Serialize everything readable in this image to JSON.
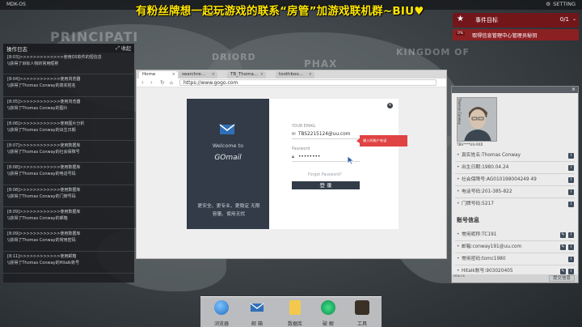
{
  "topbar": {
    "os_label": "MDK-OS",
    "banner": "有粉丝牌想一起玩游戏的联系“房管”加游戏联机群~BIU",
    "setting_label": "SETTING"
  },
  "map": {
    "labels": [
      "PRINCIPATI",
      "DRIORD",
      "PHAX",
      "KINGDOM OF"
    ]
  },
  "log_panel": {
    "title": "操作日志",
    "collapse_label": "收起",
    "entries": [
      {
        "line1": "[8:03]>>>>>>>>>>>>>使用OS软件的短信息",
        "line2": "\\\\获得了目标人物的常用昵称"
      },
      {
        "line1": "[8:04]>>>>>>>>>>>>使用浏览器",
        "line2": "\\\\获得了Thomas Conway的真实姓名"
      },
      {
        "line1": "[8:05]>>>>>>>>>>>>使用浏览器",
        "line2": "\\\\获得了Thomas Conway的图片"
      },
      {
        "line1": "[8:06]>>>>>>>>>>>>使用图片分析",
        "line2": "\\\\获得了Thomas Conway的出生日期"
      },
      {
        "line1": "[8:07]>>>>>>>>>>>>使用数据库",
        "line2": "\\\\获得了Thomas Conway的社会保障号"
      },
      {
        "line1": "[8:08]>>>>>>>>>>>>使用数据库",
        "line2": "\\\\获得了Thomas Conway的电话号码"
      },
      {
        "line1": "[8:08]>>>>>>>>>>>>使用数据库",
        "line2": "\\\\获得了Thomas Conway的门牌号码"
      },
      {
        "line1": "[8:09]>>>>>>>>>>>>使用数据库",
        "line2": "\\\\获得了Thomas Conway的邮箱"
      },
      {
        "line1": "[8:09]>>>>>>>>>>>>使用数据库",
        "line2": "\\\\获得了Thomas Conway的常用密码"
      },
      {
        "line1": "[8:11]>>>>>>>>>>>>使用邮箱",
        "line2": "\\\\获得了Thomas Conway的Hitalk账号"
      }
    ]
  },
  "browser": {
    "tabs": [
      "Home",
      "searchre...",
      "TB_Thoma...",
      "toothboo..."
    ],
    "url": "https://www.gogo.com"
  },
  "mail": {
    "welcome": "Welcome to",
    "brand": "GOmail",
    "slogan": "更安全、更专业、更稳定 无限容量、使用无忧",
    "email_label": "YOUR EMAIL",
    "email_value": "TBS2215124@uu.com",
    "password_label": "Password",
    "password_value": "••••••••",
    "forgot": "Forget Password?",
    "login_label": "登 录",
    "tooltip": "输入的账户有误"
  },
  "objective": {
    "title": "事件目标",
    "count": "0/1",
    "progress": "0%",
    "text": "取得信息管理中心管理员秘钥"
  },
  "profile": {
    "photo_tag": "Thomas Conway",
    "id": "TBS****UU-XXX",
    "personal": [
      "真实姓名:Thomas Conway",
      "出生日期:1980.04.24",
      "社会保障号:AG010198004249 49",
      "电话号码:201-385-822",
      "门牌号码:5217"
    ],
    "account_title": "账号信息",
    "accounts": [
      "常用昵称:TC191",
      "邮箱:conway191@uu.com",
      "常用密码:tomc1980",
      "Hitalk账号:903020405"
    ],
    "bottom_label": "MDK-OS",
    "submit_label": "提交信息"
  },
  "dock": {
    "items": [
      "浏览器",
      "邮 箱",
      "数据库",
      "破 解",
      "工具"
    ]
  },
  "colors": {
    "objective_red": "#961e20",
    "banner_yellow": "#ffe600",
    "mail_navy": "#323b47",
    "tooltip_red": "#e04343"
  }
}
